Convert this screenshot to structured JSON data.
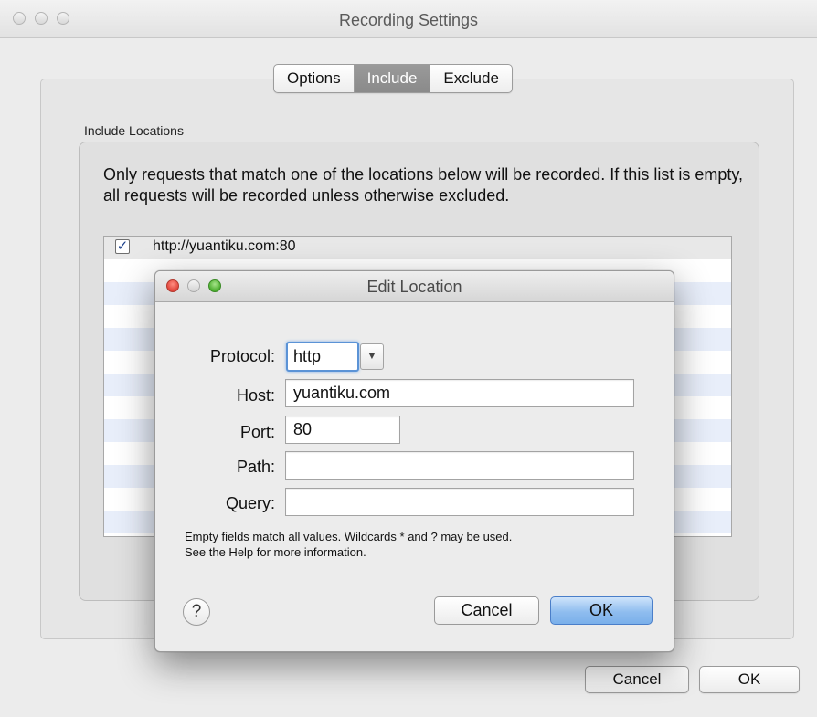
{
  "window": {
    "title": "Recording Settings",
    "tabs": [
      {
        "label": "Options",
        "active": false
      },
      {
        "label": "Include",
        "active": true
      },
      {
        "label": "Exclude",
        "active": false
      }
    ],
    "group_label": "Include Locations",
    "description": "Only requests that match one of the locations below will be recorded. If this list is empty, all requests will be recorded unless otherwise excluded.",
    "locations": [
      {
        "checked": true,
        "url": "http://yuantiku.com:80"
      }
    ],
    "cancel_label": "Cancel",
    "ok_label": "OK"
  },
  "dialog": {
    "title": "Edit Location",
    "protocol_label": "Protocol:",
    "protocol_value": "http",
    "host_label": "Host:",
    "host_value": "yuantiku.com",
    "port_label": "Port:",
    "port_value": "80",
    "path_label": "Path:",
    "path_value": "",
    "query_label": "Query:",
    "query_value": "",
    "hint_line1": "Empty fields match all values. Wildcards * and ? may be used.",
    "hint_line2": "See the Help for more information.",
    "help_label": "?",
    "cancel_label": "Cancel",
    "ok_label": "OK"
  },
  "colors": {
    "accent": "#5b93d6",
    "close": "#e0443a",
    "zoom": "#4cae2f"
  }
}
